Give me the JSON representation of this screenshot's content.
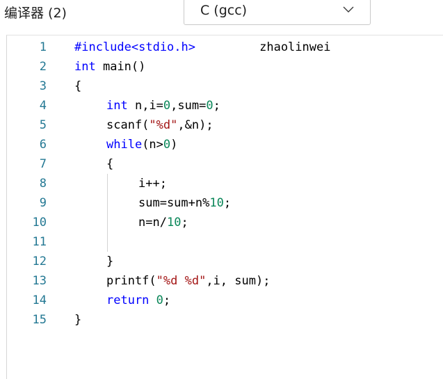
{
  "header": {
    "compiler_label": "编译器 (2)",
    "compiler_select": {
      "value": "C (gcc)"
    }
  },
  "editor": {
    "lines": [
      {
        "number": "1",
        "indent": 0,
        "tokens": [
          {
            "t": "#include<stdio.h>",
            "k": "keyword"
          },
          {
            "t": "         zhaolinwei",
            "k": "plain"
          }
        ]
      },
      {
        "number": "2",
        "indent": 0,
        "tokens": [
          {
            "t": "int",
            "k": "keyword"
          },
          {
            "t": " main()",
            "k": "plain"
          }
        ]
      },
      {
        "number": "3",
        "indent": 0,
        "tokens": [
          {
            "t": "{",
            "k": "plain"
          }
        ]
      },
      {
        "number": "4",
        "indent": 1,
        "tokens": [
          {
            "t": "int",
            "k": "keyword"
          },
          {
            "t": " n,i=",
            "k": "plain"
          },
          {
            "t": "0",
            "k": "number"
          },
          {
            "t": ",sum=",
            "k": "plain"
          },
          {
            "t": "0",
            "k": "number"
          },
          {
            "t": ";",
            "k": "plain"
          }
        ]
      },
      {
        "number": "5",
        "indent": 1,
        "tokens": [
          {
            "t": "scanf(",
            "k": "plain"
          },
          {
            "t": "\"%d\"",
            "k": "string"
          },
          {
            "t": ",&n);",
            "k": "plain"
          }
        ]
      },
      {
        "number": "6",
        "indent": 1,
        "tokens": [
          {
            "t": "while",
            "k": "keyword"
          },
          {
            "t": "(n>",
            "k": "plain"
          },
          {
            "t": "0",
            "k": "number"
          },
          {
            "t": ")",
            "k": "plain"
          }
        ]
      },
      {
        "number": "7",
        "indent": 1,
        "tokens": [
          {
            "t": "{",
            "k": "plain"
          }
        ]
      },
      {
        "number": "8",
        "indent": 2,
        "tokens": [
          {
            "t": "i++;",
            "k": "plain"
          }
        ]
      },
      {
        "number": "9",
        "indent": 2,
        "tokens": [
          {
            "t": "sum=sum+n%",
            "k": "plain"
          },
          {
            "t": "10",
            "k": "number"
          },
          {
            "t": ";",
            "k": "plain"
          }
        ]
      },
      {
        "number": "10",
        "indent": 2,
        "tokens": [
          {
            "t": "n=n/",
            "k": "plain"
          },
          {
            "t": "10",
            "k": "number"
          },
          {
            "t": ";",
            "k": "plain"
          }
        ]
      },
      {
        "number": "11",
        "indent": 2,
        "tokens": []
      },
      {
        "number": "12",
        "indent": 1,
        "tokens": [
          {
            "t": "}",
            "k": "plain"
          }
        ]
      },
      {
        "number": "13",
        "indent": 1,
        "tokens": [
          {
            "t": "printf(",
            "k": "plain"
          },
          {
            "t": "\"%d %d\"",
            "k": "string"
          },
          {
            "t": ",i, sum);",
            "k": "plain"
          }
        ]
      },
      {
        "number": "14",
        "indent": 1,
        "tokens": [
          {
            "t": "return",
            "k": "keyword"
          },
          {
            "t": " ",
            "k": "plain"
          },
          {
            "t": "0",
            "k": "number"
          },
          {
            "t": ";",
            "k": "plain"
          }
        ]
      },
      {
        "number": "15",
        "indent": 0,
        "tokens": [
          {
            "t": "}",
            "k": "plain"
          }
        ]
      }
    ],
    "colors": {
      "keyword": "#0000ff",
      "string": "#a31515",
      "number": "#098658",
      "plain": "#000000",
      "line_number": "#237893"
    }
  }
}
